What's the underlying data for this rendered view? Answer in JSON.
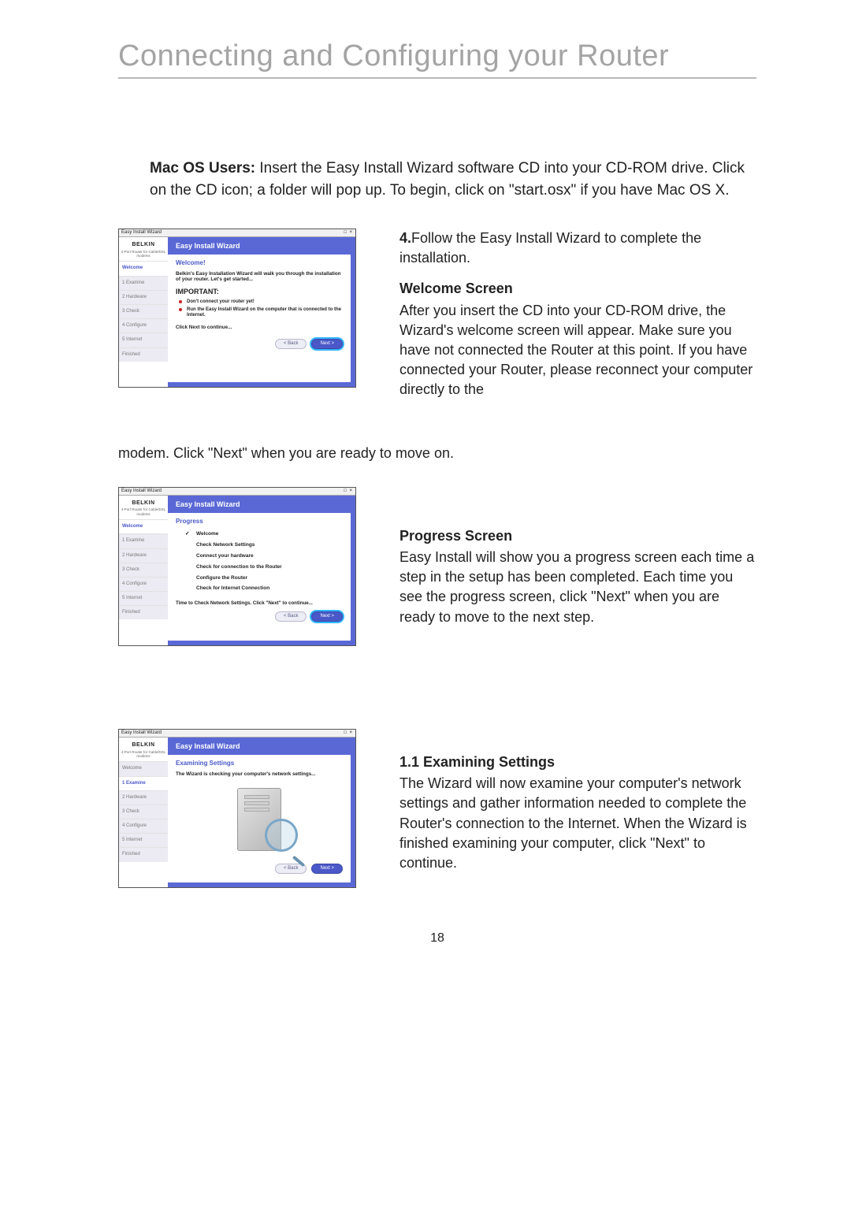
{
  "title": "Connecting and Configuring your Router",
  "intro_bold": "Mac OS Users:",
  "intro_rest": " Insert the Easy Install Wizard software CD into your CD-ROM drive. Click on the CD icon; a folder will pop up. To begin, click on \"start.osx\" if you have Mac OS X.",
  "step4_lead": "4.",
  "step4_text": "Follow the Easy Install Wizard to complete the installation.",
  "welcome_head": "Welcome Screen",
  "welcome_body_inline": "After you insert the CD into your CD-ROM drive, the Wizard's welcome screen will appear. Make sure you have not connected the Router at this point. If you have connected your Router, please reconnect your computer directly to the",
  "welcome_overflow": "modem. Click \"Next\" when you are ready to move on.",
  "progress_head": "Progress Screen",
  "progress_body": "Easy Install will show you a progress screen each time a step in the setup has been completed. Each time you see the progress screen, click \"Next\" when you are ready to move to the next step.",
  "examine_head": "1.1 Examining Settings",
  "examine_body": "The Wizard will now examine your computer's network settings and gather information needed to complete the Router's connection to the Internet. When the Wizard is finished examining your computer, click \"Next\" to continue.",
  "page_number": "18",
  "wizard": {
    "window_title": "Easy Install Wizard",
    "brand": "BELKIN",
    "brand_sub": "4-Port Router for Cable/DSL modems",
    "banner": "Easy Install Wizard",
    "steps": [
      "Welcome",
      "1 Examine",
      "2 Hardware",
      "3 Check",
      "4 Configure",
      "5 Internet",
      "Finished"
    ],
    "back": "< Back",
    "next": "Next >",
    "screen1": {
      "heading": "Welcome!",
      "line1": "Belkin's Easy Installation Wizard will walk you through the installation of your router. Let's get started...",
      "important": "IMPORTANT:",
      "b1": "Don't connect your router yet!",
      "b2": "Run the Easy Install Wizard on the computer that is connected to the Internet.",
      "cont": "Click Next to continue..."
    },
    "screen2": {
      "heading": "Progress",
      "items": [
        "Welcome",
        "Check Network Settings",
        "Connect your hardware",
        "Check for connection to the Router",
        "Configure the Router",
        "Check for Internet Connection"
      ],
      "foot": "Time to Check Network Settings. Click \"Next\" to continue..."
    },
    "screen3": {
      "heading": "Examining Settings",
      "line1": "The Wizard is checking your computer's network settings..."
    }
  }
}
